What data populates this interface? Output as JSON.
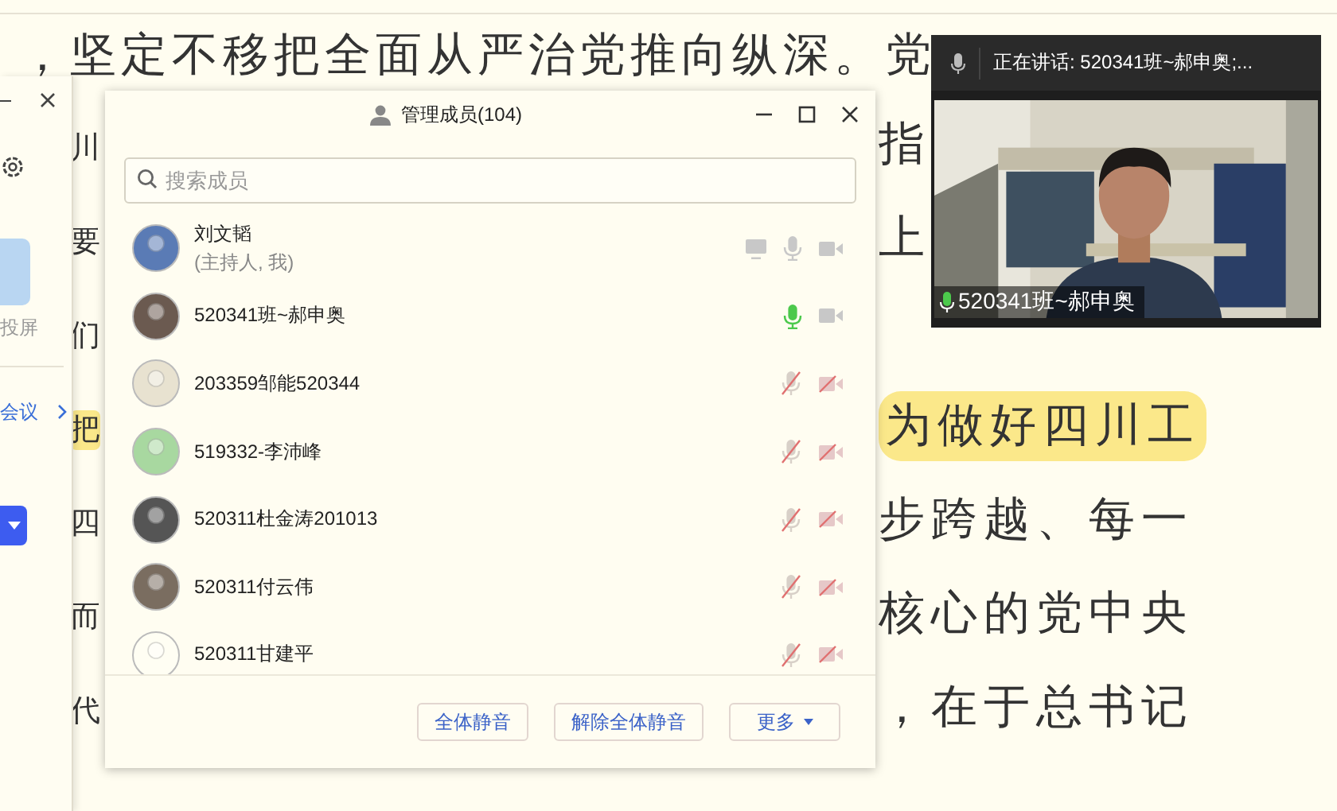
{
  "document": {
    "first_line": "，坚定不移把全面从严治党推向纵深。党",
    "lines": [
      {
        "left": "川",
        "right": "指",
        "highlighted": false
      },
      {
        "left": "要",
        "right": "上",
        "highlighted": false
      },
      {
        "left": "们",
        "highlighted": false
      },
      {
        "left": "把",
        "right": "为做好四川工",
        "highlighted": true
      },
      {
        "left": "四",
        "right": "步跨越、每一",
        "highlighted": false
      },
      {
        "left": "而",
        "right": "核心的党中央",
        "highlighted": false
      },
      {
        "left": "代",
        "right": "，在于总书记",
        "highlighted": false
      }
    ]
  },
  "side_panel": {
    "tile_label": "投屏",
    "link": "会议"
  },
  "members_dialog": {
    "title": "管理成员(104)",
    "search": {
      "placeholder": "搜索成员"
    },
    "members": [
      {
        "name": "刘文韬",
        "role": "(主持人, 我)",
        "share": true,
        "speaking": false,
        "muted": false,
        "camera_off": false
      },
      {
        "name": "520341班~郝申奥",
        "share": false,
        "speaking": true,
        "muted": false,
        "camera_off": false
      },
      {
        "name": "203359邹能520344",
        "share": false,
        "speaking": false,
        "muted": true,
        "camera_off": true
      },
      {
        "name": "519332-李沛峰",
        "share": false,
        "speaking": false,
        "muted": true,
        "camera_off": true
      },
      {
        "name": "520311杜金涛201013",
        "share": false,
        "speaking": false,
        "muted": true,
        "camera_off": true
      },
      {
        "name": "520311付云伟",
        "share": false,
        "speaking": false,
        "muted": true,
        "camera_off": true
      },
      {
        "name": "520311甘建平",
        "share": false,
        "speaking": false,
        "muted": true,
        "camera_off": true
      }
    ],
    "buttons": [
      {
        "label": "全体静音",
        "kind": "plain"
      },
      {
        "label": "解除全体静音",
        "kind": "plain"
      },
      {
        "label": "更多",
        "kind": "menu"
      }
    ]
  },
  "video_window": {
    "speaking": "正在讲话: 520341班~郝申奥;...",
    "caption": "520341班~郝申奥"
  }
}
